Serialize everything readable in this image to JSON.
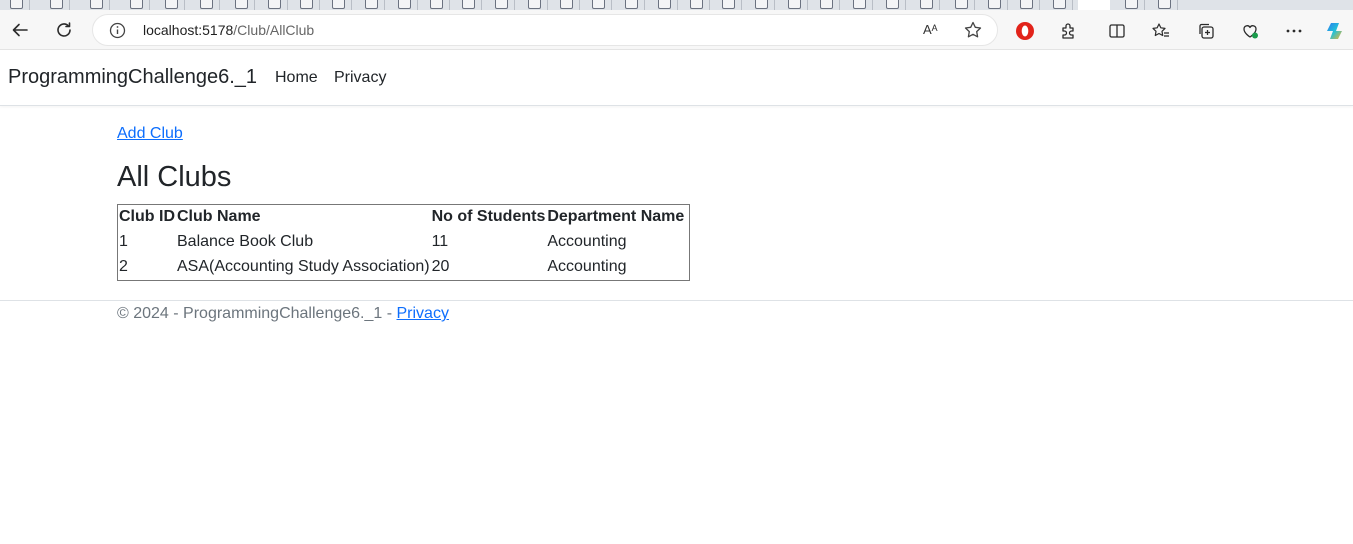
{
  "browser": {
    "url_host": "localhost:5178",
    "url_path": "/Club/AllClub",
    "read_aloud_glyph": "Aᴬ",
    "colors": {
      "toolbar_bg": "#f7f7f7",
      "omnibox_bg": "#ffffff"
    }
  },
  "navbar": {
    "brand": "ProgrammingChallenge6._1",
    "links": [
      {
        "label": "Home"
      },
      {
        "label": "Privacy"
      }
    ]
  },
  "main": {
    "add_link": "Add Club",
    "heading": "All Clubs",
    "table": {
      "headers": [
        "Club ID",
        "Club Name",
        "No of Students",
        "Department Name"
      ],
      "rows": [
        [
          "1",
          "Balance Book Club",
          "11",
          "Accounting"
        ],
        [
          "2",
          "ASA(Accounting Study Association)",
          "20",
          "Accounting"
        ]
      ]
    }
  },
  "footer": {
    "text": "© 2024 - ProgrammingChallenge6._1 - ",
    "privacy_link": "Privacy"
  },
  "colors": {
    "link": "#0d6efd",
    "text": "#212529",
    "muted": "#6c757d",
    "border": "#dee2e6"
  }
}
